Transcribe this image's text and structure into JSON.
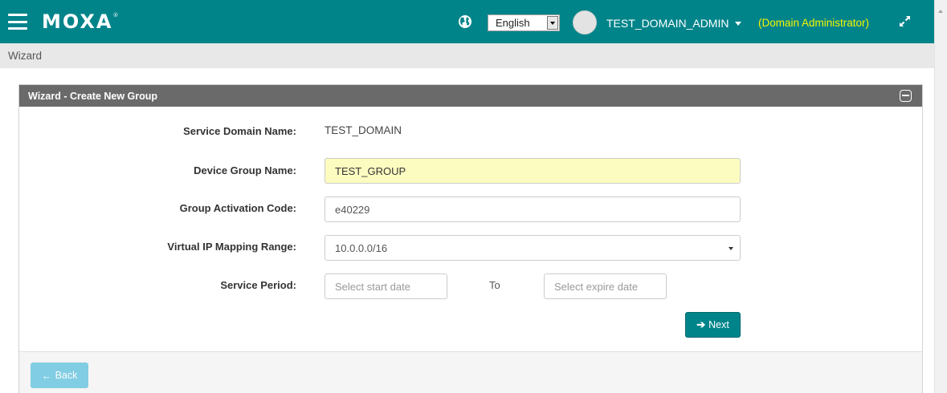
{
  "header": {
    "logo": "MOXA",
    "logo_mark": "®",
    "language": "English",
    "user": "TEST_DOMAIN_ADMIN",
    "role": "(Domain Administrator)"
  },
  "breadcrumb": "Wizard",
  "panel": {
    "title": "Wizard - Create New Group"
  },
  "form": {
    "service_domain": {
      "label": "Service Domain Name:",
      "value": "TEST_DOMAIN"
    },
    "device_group": {
      "label": "Device Group Name:",
      "value": "TEST_GROUP"
    },
    "activation_code": {
      "label": "Group Activation Code:",
      "value": "e40229"
    },
    "ip_range": {
      "label": "Virtual IP Mapping Range:",
      "value": "10.0.0.0/16"
    },
    "service_period": {
      "label": "Service Period:",
      "start_placeholder": "Select start date",
      "to": "To",
      "end_placeholder": "Select expire date"
    }
  },
  "buttons": {
    "next": "Next",
    "back": "Back"
  },
  "colors": {
    "brand": "#00848a",
    "role_text": "#f5f500",
    "highlight_field": "#fdfcc0",
    "back_button": "#5bc0de"
  }
}
